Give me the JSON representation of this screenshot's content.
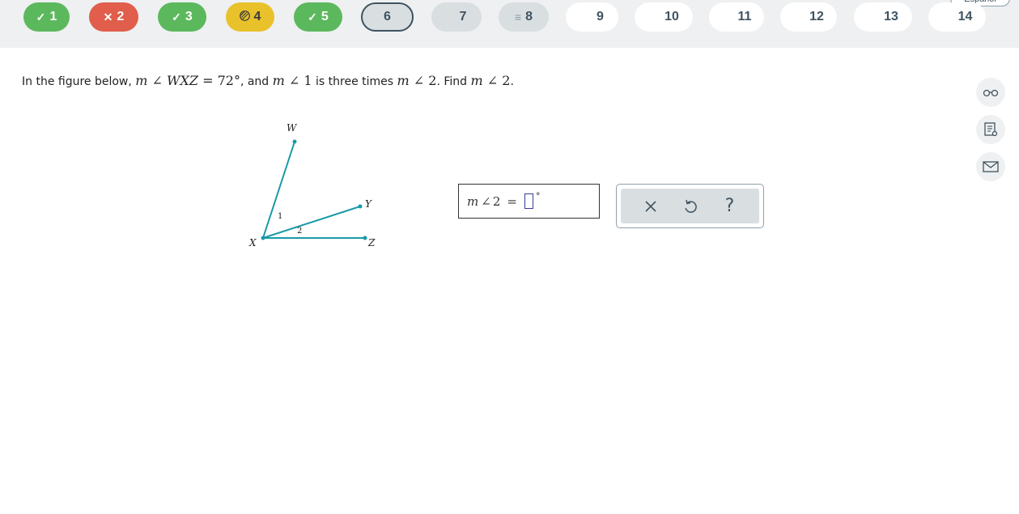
{
  "language_button": "Español",
  "questions": [
    {
      "label": "1",
      "status": "correct",
      "icon": "check-icon",
      "glyph": "✓"
    },
    {
      "label": "2",
      "status": "incorrect",
      "icon": "x-icon",
      "glyph": "✕"
    },
    {
      "label": "3",
      "status": "correct",
      "icon": "check-icon",
      "glyph": "✓"
    },
    {
      "label": "4",
      "status": "partial",
      "icon": "hatched-circle-icon",
      "glyph": ""
    },
    {
      "label": "5",
      "status": "correct",
      "icon": "check-icon",
      "glyph": "✓"
    },
    {
      "label": "6",
      "status": "current",
      "icon": "",
      "glyph": ""
    },
    {
      "label": "7",
      "status": "visited",
      "icon": "",
      "glyph": ""
    },
    {
      "label": "8",
      "status": "visited",
      "icon": "lines-icon",
      "glyph": "≡"
    },
    {
      "label": "9",
      "status": "unvisited",
      "icon": "",
      "glyph": ""
    },
    {
      "label": "10",
      "status": "unvisited",
      "icon": "",
      "glyph": ""
    },
    {
      "label": "11",
      "status": "unvisited",
      "icon": "",
      "glyph": ""
    },
    {
      "label": "12",
      "status": "unvisited",
      "icon": "",
      "glyph": ""
    },
    {
      "label": "13",
      "status": "unvisited",
      "icon": "",
      "glyph": ""
    },
    {
      "label": "14",
      "status": "unvisited",
      "icon": "",
      "glyph": ""
    }
  ],
  "question": {
    "intro": "In the figure below, ",
    "m1": "m",
    "angle_sym": "∠",
    "wxz": "WXZ",
    "eq72": " = 72°",
    "and_text": ", and ",
    "one": " 1",
    "three_times": " is three times ",
    "two": " 2",
    "find_text": ". Find ",
    "two_b": " 2",
    "period": "."
  },
  "figure": {
    "points": {
      "W": "W",
      "X": "X",
      "Y": "Y",
      "Z": "Z"
    },
    "angle_labels": {
      "a1": "1",
      "a2": "2"
    },
    "line_color": "#1a9aa8"
  },
  "answer": {
    "m": "m",
    "angle_sym": "∠",
    "num": "2",
    "eq": "=",
    "value": "",
    "degree": "°"
  },
  "tools": {
    "clear": "×",
    "undo": "undo-icon",
    "help": "?"
  },
  "side_tools": [
    "glasses-icon",
    "notepad-icon",
    "mail-icon"
  ],
  "colors": {
    "correct": "#5cb85c",
    "incorrect": "#e05e4b",
    "partial": "#e8c12b",
    "current_border": "#3f5360",
    "accent": "#1a9aa8"
  }
}
